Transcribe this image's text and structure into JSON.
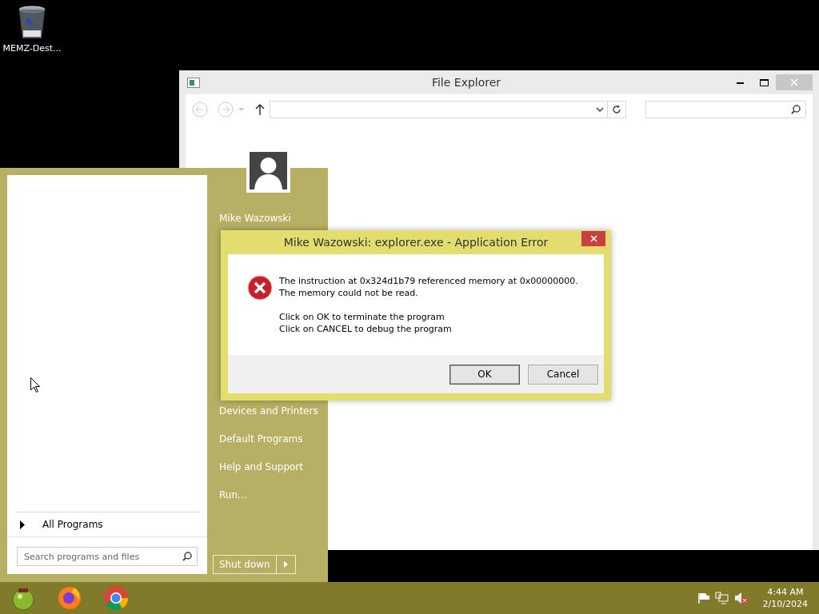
{
  "desktop": {
    "icons": [
      {
        "label": "MEMZ-Dest..."
      }
    ]
  },
  "explorer": {
    "title": "File Explorer"
  },
  "start_menu": {
    "user_name": "Mike Wazowski",
    "places": [
      {
        "label": "Devices and Printers"
      },
      {
        "label": "Default Programs"
      },
      {
        "label": "Help and Support"
      },
      {
        "label": "Run..."
      }
    ],
    "all_programs": "All Programs",
    "search": {
      "placeholder": "Search programs and files"
    },
    "shutdown": "Shut down"
  },
  "dialog": {
    "title": "Mike Wazowski: explorer.exe - Application Error",
    "message": [
      "The instruction at 0x324d1b79 referenced memory at 0x00000000. The memory could not be read.",
      "Click on OK to terminate the program",
      "Click on CANCEL to debug the program"
    ],
    "buttons": [
      {
        "label": "OK",
        "kind": "default"
      },
      {
        "label": "Cancel",
        "kind": "normal"
      }
    ]
  },
  "taskbar": {
    "apps": [
      {
        "kind": "ornament"
      },
      {
        "kind": "firefox"
      },
      {
        "kind": "chrome"
      }
    ],
    "time": "4:44 AM",
    "date": "2/10/2024"
  }
}
